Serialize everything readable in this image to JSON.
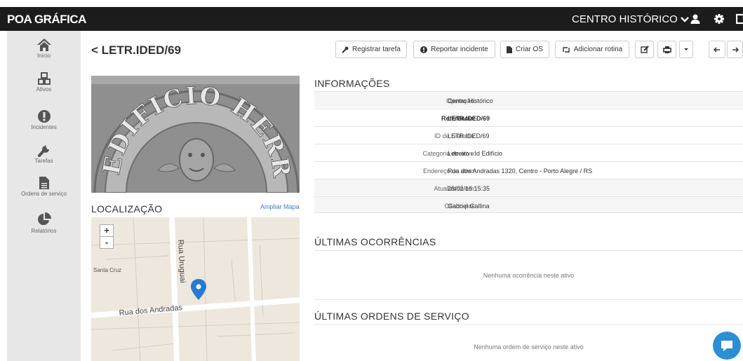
{
  "topbar": {
    "brand": "POA GRÁFICA",
    "city": "CENTRO HISTÓRICO",
    "icons": [
      "user-icon",
      "gear-icon",
      "exit-icon"
    ]
  },
  "sidebar": {
    "items": [
      {
        "label": "Início",
        "icon": "home-icon"
      },
      {
        "label": "Ativos",
        "icon": "cubes-icon"
      },
      {
        "label": "Incidentes",
        "icon": "exclamation-icon"
      },
      {
        "label": "Tarefas",
        "icon": "wrench-icon"
      },
      {
        "label": "Ordens de serviço",
        "icon": "file-icon"
      },
      {
        "label": "Relatórios",
        "icon": "pie-chart-icon"
      }
    ]
  },
  "page": {
    "title": "< LETR.IDED/69"
  },
  "toolbar": {
    "register_task": "Registrar tarefa",
    "report_incident": "Reportar incidente",
    "create_os": "Criar OS",
    "add_routine": "Adicionar rotina"
  },
  "location": {
    "title": "LOCALIZAÇÃO",
    "expand_link": "Ampliar Mapa",
    "map": {
      "street_1": "Rua Uruguai",
      "street_2": "Rua dos Andradas",
      "place": "Santa Cruz",
      "zoom_in": "+",
      "zoom_out": "-"
    }
  },
  "photo": {
    "facade_text": "EDIFICIO HERRMANN"
  },
  "info": {
    "title": "INFORMAÇÕES",
    "rows": [
      {
        "key": "Operação:",
        "value": "Centro Histórico"
      },
      {
        "key": "Referência:",
        "value": "LETR.IDED/69"
      },
      {
        "key": "ID de Sistema:",
        "value": "LETR.IDED/69"
      },
      {
        "key": "Categoria do ativo:",
        "value": "Letreiro › Id Edifício"
      },
      {
        "key": "Endereço do ativo:",
        "value": "Rua dos Andradas 1320, Centro - Porto Alegre / RS"
      },
      {
        "key": "Atualizado em:",
        "value": "28/02/16 15:35"
      },
      {
        "key": "Criado por:",
        "value": "Gabriel Gallina"
      }
    ]
  },
  "occurrences": {
    "title": "ÚLTIMAS OCORRÊNCIAS",
    "empty": "Nenhuma ocorrência neste ativo"
  },
  "service_orders": {
    "title": "ÚLTIMAS ORDENS DE SERVIÇO",
    "empty": "Nenhuma ordem de serviço neste ativo"
  },
  "colors": {
    "topbar": "#1c1c1c",
    "sidebar": "#e7e7e7",
    "link": "#3a7bd5",
    "map_pin": "#2b7ad0",
    "chat": "#2b8fd6"
  }
}
